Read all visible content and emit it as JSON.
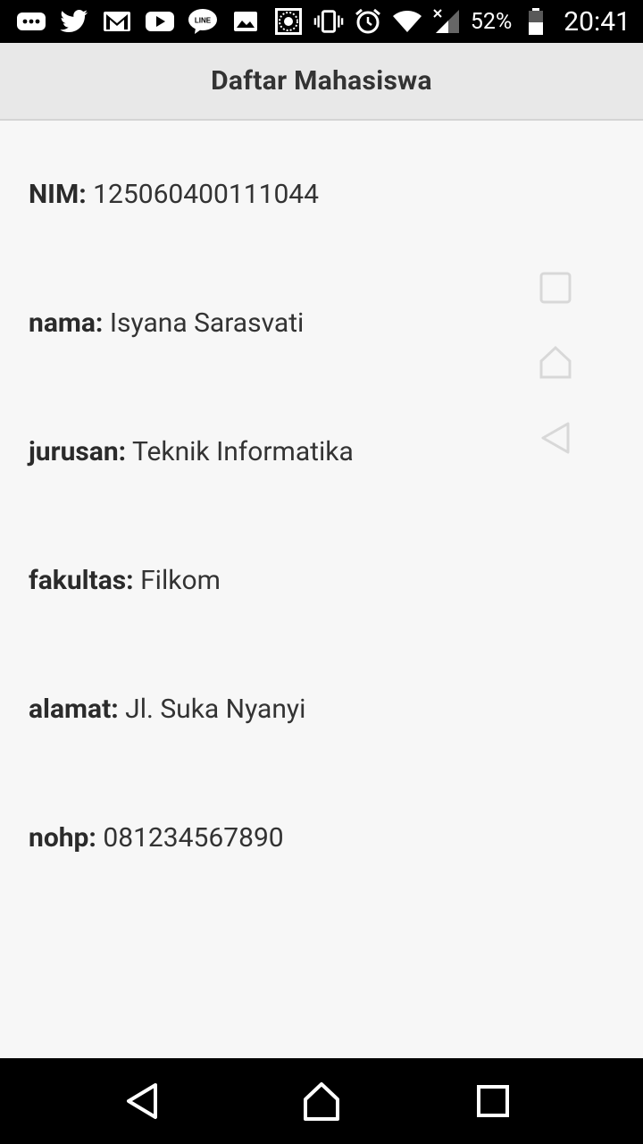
{
  "status_bar": {
    "left_icons": [
      "more-icon",
      "twitter-icon",
      "gmail-icon",
      "youtube-icon",
      "line-icon",
      "gallery-icon",
      "quran-icon"
    ],
    "right_icons": [
      "vibrate-icon",
      "alarm-icon",
      "wifi-icon",
      "signal-icon"
    ],
    "battery_percent": "52%",
    "time": "20:41"
  },
  "action_bar": {
    "title": "Daftar Mahasiswa"
  },
  "student": {
    "nim_label": "NIM:",
    "nim_value": "125060400111044",
    "nama_label": "nama:",
    "nama_value": "Isyana Sarasvati",
    "jurusan_label": "jurusan:",
    "jurusan_value": "Teknik Informatika",
    "fakultas_label": "fakultas:",
    "fakultas_value": "Filkom",
    "alamat_label": "alamat:",
    "alamat_value": "Jl. Suka Nyanyi",
    "nohp_label": "nohp:",
    "nohp_value": "081234567890"
  },
  "nav_bar": {
    "buttons": [
      "back-icon",
      "home-icon",
      "recent-apps-icon"
    ]
  },
  "colors": {
    "status_bar": "#000000",
    "action_bar": "#e8e8e8",
    "background": "#f7f7f7",
    "text": "#333333"
  }
}
